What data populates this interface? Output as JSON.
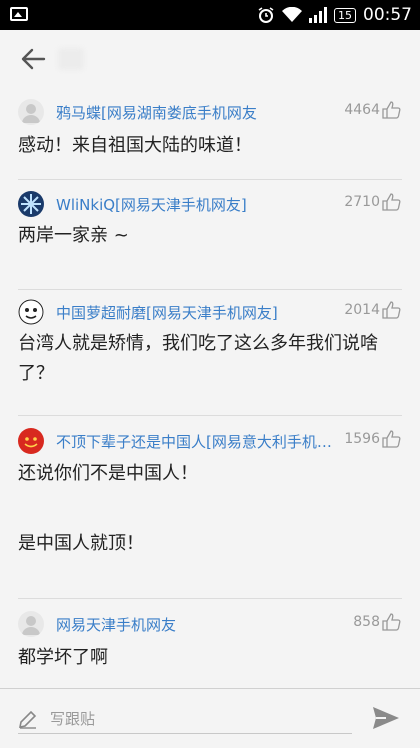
{
  "status_bar": {
    "time": "00:57",
    "battery": "15"
  },
  "comments": [
    {
      "user": "鸦马蝶[网易湖南娄底手机网友",
      "likes": "4464",
      "text": "感动！来自祖国大陆的味道！"
    },
    {
      "user": "WliNkiQ[网易天津手机网友]",
      "likes": "2710",
      "text": "两岸一家亲 ~"
    },
    {
      "user": "中国萝超耐磨[网易天津手机网友]",
      "likes": "2014",
      "text": "台湾人就是矫情，我们吃了这么多年我们说啥了？"
    },
    {
      "user": "不顶下辈子还是中国人[网易意大利手机网...",
      "likes": "1596",
      "text": "还说你们不是中国人！",
      "text2": "是中国人就顶！"
    },
    {
      "user": "网易天津手机网友",
      "likes": "858",
      "text": "都学坏了啊"
    }
  ],
  "reply": {
    "placeholder": "写跟贴"
  }
}
